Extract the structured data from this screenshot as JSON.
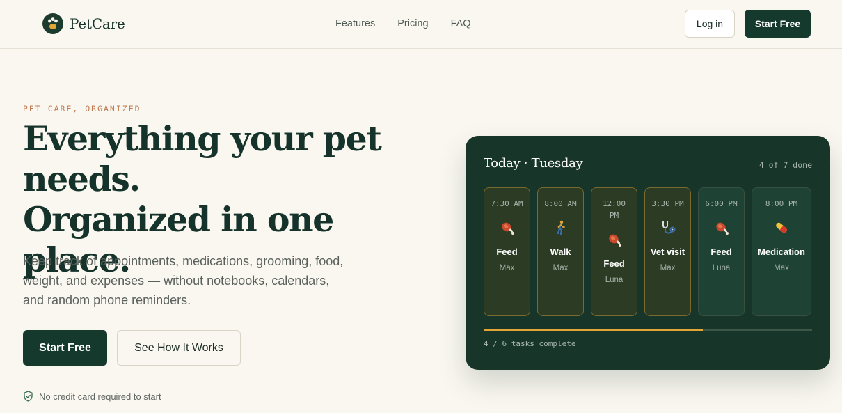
{
  "brand": {
    "name": "PetCare",
    "logo_icon": "paw-icon"
  },
  "nav": {
    "items": [
      "Features",
      "Pricing",
      "FAQ"
    ]
  },
  "header": {
    "login_label": "Log in",
    "start_label": "Start Free"
  },
  "hero": {
    "eyebrow": "PET CARE, ORGANIZED",
    "title_lines": [
      "Everything your pet",
      "needs.",
      "Organized in one place."
    ],
    "subtitle": "Keep track of appointments, medications, grooming, food, weight, and expenses — without notebooks, calendars, and random phone reminders.",
    "primary_label": "Start Free",
    "secondary_label": "See How It Works",
    "note": "No credit card required to start",
    "note_icon": "shield-check-icon"
  },
  "card": {
    "title": "Today · Tuesday",
    "count": "4 of 7 done",
    "tasks": [
      {
        "time": "7:30 AM",
        "icon": "meat-icon",
        "name": "Feed",
        "pet": "Max",
        "done": true
      },
      {
        "time": "8:00 AM",
        "icon": "walking-person-icon",
        "name": "Walk",
        "pet": "Max",
        "done": true
      },
      {
        "time": "12:00 PM",
        "icon": "meat-icon",
        "name": "Feed",
        "pet": "Luna",
        "done": true
      },
      {
        "time": "3:30 PM",
        "icon": "stethoscope-icon",
        "name": "Vet visit",
        "pet": "Max",
        "done": true
      },
      {
        "time": "6:00 PM",
        "icon": "meat-icon",
        "name": "Feed",
        "pet": "Luna",
        "done": false
      },
      {
        "time": "8:00 PM",
        "icon": "pill-icon",
        "name": "Medication",
        "pet": "Max",
        "done": false
      }
    ],
    "progress": {
      "completed": 4,
      "total": 6,
      "label": "4 / 6 tasks complete"
    },
    "colors": {
      "accent": "#e3a536",
      "card_bg": "#173629"
    }
  }
}
